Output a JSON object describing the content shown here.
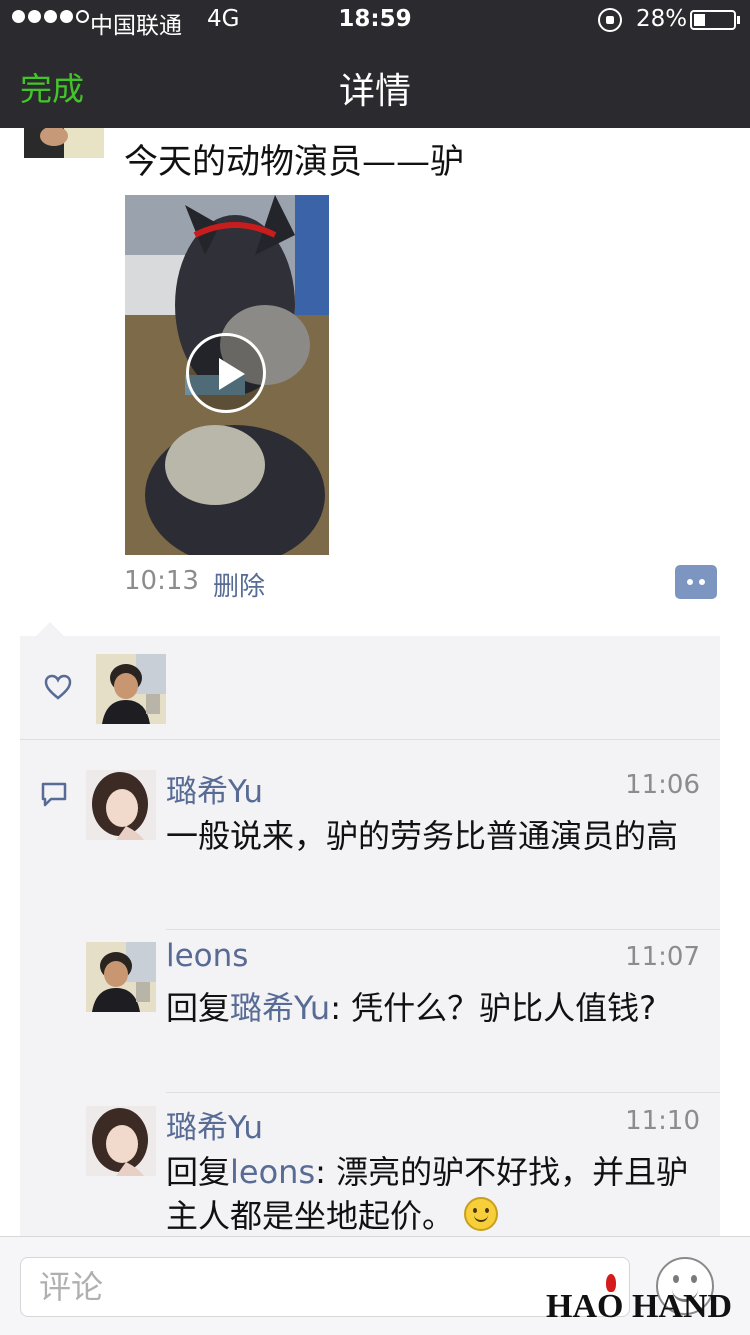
{
  "status_bar": {
    "carrier": "中国联通",
    "network": "4G",
    "time": "18:59",
    "battery_percent": "28%",
    "battery_level": 0.28
  },
  "nav": {
    "done_label": "完成",
    "title": "详情"
  },
  "post": {
    "text": "今天的动物演员——驴",
    "time": "10:13",
    "delete_label": "删除"
  },
  "comments": [
    {
      "name": "璐希Yu",
      "time": "11:06",
      "text": "一般说来，驴的劳务比普通演员的高"
    },
    {
      "name": "leons",
      "time": "11:07",
      "reply_prefix": "回复",
      "reply_to": "璐希Yu",
      "text": ": 凭什么？驴比人值钱?"
    },
    {
      "name": "璐希Yu",
      "time": "11:10",
      "reply_prefix": "回复",
      "reply_to": "leons",
      "text": ": 漂亮的驴不好找，并且驴主人都是坐地起价。"
    }
  ],
  "input": {
    "placeholder": "评论"
  },
  "watermark": "HAO HAND",
  "colors": {
    "nav_bg": "#2b2b2f",
    "done_green": "#43c52a",
    "link_blue": "#576b95",
    "panel_bg": "#f3f3f5"
  }
}
